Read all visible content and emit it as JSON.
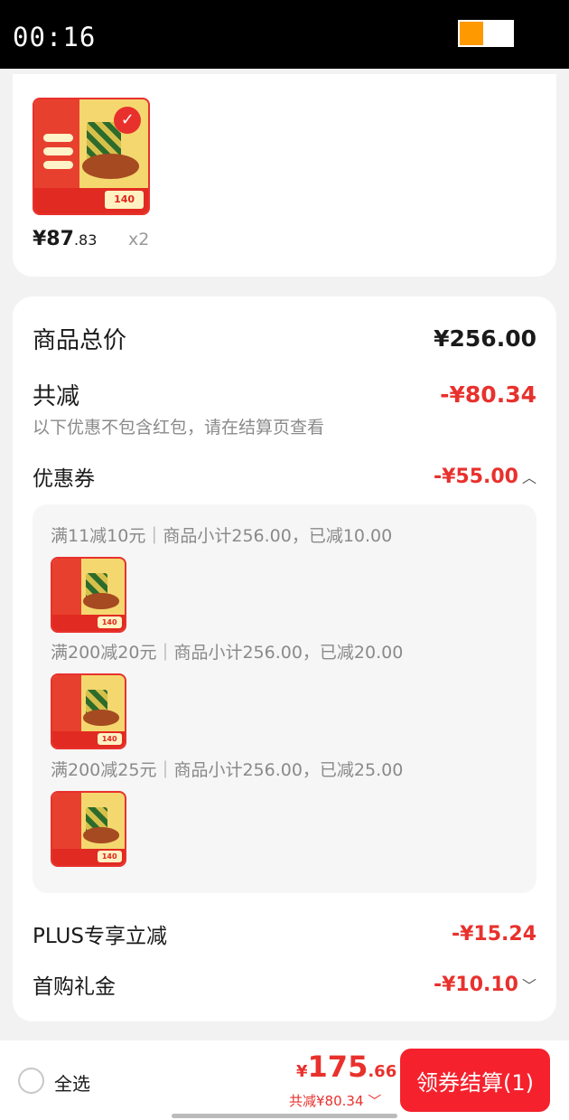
{
  "status": {
    "time": "00:16",
    "battery_level": 0.45
  },
  "product": {
    "price_main": "¥87",
    "price_decimal": ".83",
    "quantity": "x2",
    "thumb_tag": "140"
  },
  "summary": {
    "subtotal_label": "商品总价",
    "subtotal_value": "¥256.00",
    "discount_label": "共减",
    "discount_value": "-¥80.34",
    "note": "以下优惠不包含红包，请在结算页查看",
    "coupon_label": "优惠券",
    "coupon_value": "-¥55.00",
    "coupons": [
      {
        "text": "满11减10元｜商品小计256.00，已减10.00",
        "thumb_tag": "140"
      },
      {
        "text": "满200减20元｜商品小计256.00，已减20.00",
        "thumb_tag": "140"
      },
      {
        "text": "满200减25元｜商品小计256.00，已减25.00",
        "thumb_tag": "140"
      }
    ],
    "plus_label": "PLUS专享立减",
    "plus_value": "-¥15.24",
    "first_label": "首购礼金",
    "first_value": "-¥10.10"
  },
  "bottom": {
    "select_all": "全选",
    "currency": "¥",
    "total_main": "175",
    "total_decimal": ".66",
    "total_discount": "共减¥80.34",
    "checkout_label": "领券结算(1)"
  },
  "colors": {
    "accent": "#e8312d",
    "button": "#f5222d",
    "battery": "#ff9900"
  },
  "icons": [
    "battery-icon",
    "check-badge-icon",
    "chevron-up-icon",
    "chevron-down-icon",
    "radio-icon"
  ]
}
